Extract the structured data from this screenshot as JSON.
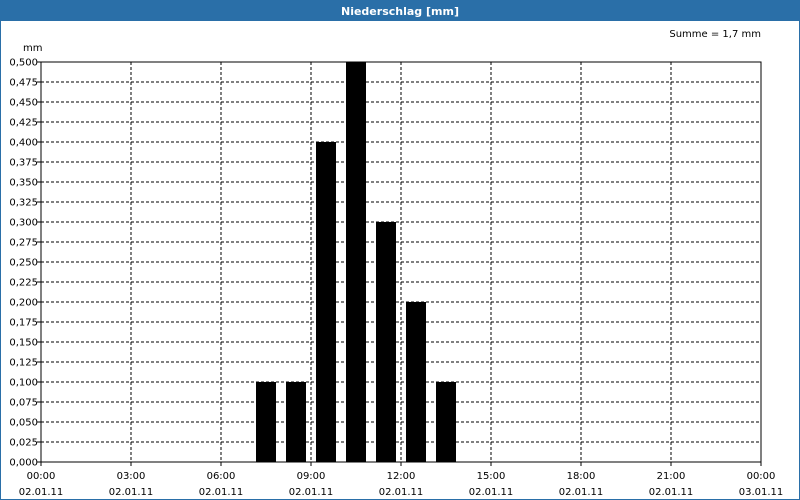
{
  "window": {
    "title": "Niederschlag [mm]"
  },
  "chart_data": {
    "type": "bar",
    "title": "Niederschlag [mm]",
    "ylabel": "mm",
    "annotation": "Summe = 1,7 mm",
    "ylim": [
      0,
      0.5
    ],
    "y_tick_step": 0.025,
    "y_ticks": [
      "0,000",
      "0,025",
      "0,050",
      "0,075",
      "0,100",
      "0,125",
      "0,150",
      "0,175",
      "0,200",
      "0,225",
      "0,250",
      "0,275",
      "0,300",
      "0,325",
      "0,350",
      "0,375",
      "0,400",
      "0,425",
      "0,450",
      "0,475",
      "0,500"
    ],
    "x_range_hours": [
      0,
      24
    ],
    "x_ticks": [
      {
        "time": "00:00",
        "date": "02.01.11"
      },
      {
        "time": "03:00",
        "date": "02.01.11"
      },
      {
        "time": "06:00",
        "date": "02.01.11"
      },
      {
        "time": "09:00",
        "date": "02.01.11"
      },
      {
        "time": "12:00",
        "date": "02.01.11"
      },
      {
        "time": "15:00",
        "date": "02.01.11"
      },
      {
        "time": "18:00",
        "date": "02.01.11"
      },
      {
        "time": "21:00",
        "date": "02.01.11"
      },
      {
        "time": "00:00",
        "date": "03.01.11"
      }
    ],
    "bars": [
      {
        "x": "07:00",
        "value": 0.1
      },
      {
        "x": "08:00",
        "value": 0.1
      },
      {
        "x": "09:00",
        "value": 0.4
      },
      {
        "x": "10:00",
        "value": 0.5
      },
      {
        "x": "11:00",
        "value": 0.3
      },
      {
        "x": "12:00",
        "value": 0.2
      },
      {
        "x": "13:00",
        "value": 0.1
      }
    ],
    "grid": true,
    "bar_color": "#000000"
  }
}
